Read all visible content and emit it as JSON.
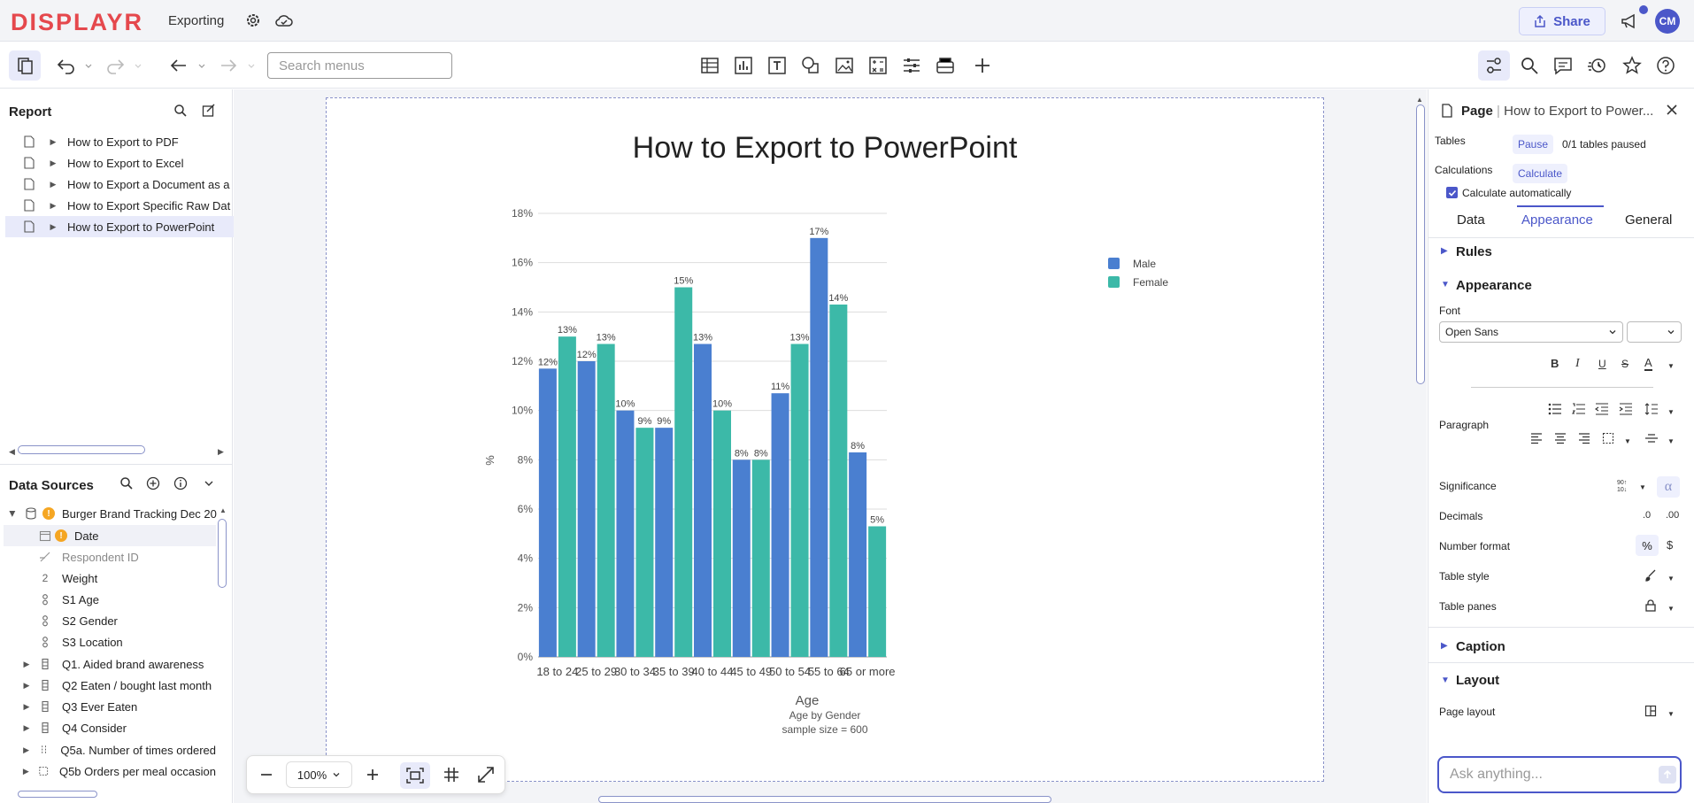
{
  "app": {
    "logo_text": "DISPLAYR",
    "document_title": "Exporting",
    "share_label": "Share",
    "user_initials": "CM"
  },
  "toolbar": {
    "search_placeholder": "Search menus"
  },
  "report": {
    "title": "Report",
    "pages": [
      {
        "label": "How to Export to PDF"
      },
      {
        "label": "How to Export to Excel"
      },
      {
        "label": "How to Export a Document as a"
      },
      {
        "label": "How to Export Specific Raw Dat"
      },
      {
        "label": "How to Export to PowerPoint",
        "selected": true
      }
    ]
  },
  "data_sources": {
    "title": "Data Sources",
    "root": "Burger Brand Tracking Dec 20",
    "items": [
      {
        "label": "Date",
        "type": "date"
      },
      {
        "label": "Respondent ID",
        "type": "id"
      },
      {
        "label": "Weight",
        "type": "numeric"
      },
      {
        "label": "S1 Age",
        "type": "categorical"
      },
      {
        "label": "S2 Gender",
        "type": "categorical"
      },
      {
        "label": "S3 Location",
        "type": "categorical"
      },
      {
        "label": "Q1. Aided brand awareness",
        "type": "multi"
      },
      {
        "label": "Q2 Eaten / bought last month",
        "type": "multi"
      },
      {
        "label": "Q3 Ever Eaten",
        "type": "multi"
      },
      {
        "label": "Q4 Consider",
        "type": "multi"
      },
      {
        "label": "Q5a. Number of times ordered",
        "type": "numeric-multi"
      },
      {
        "label": "Q5b Orders per meal occasion",
        "type": "numeric-multi"
      }
    ]
  },
  "zoom": {
    "value": "100%"
  },
  "right_panel": {
    "header_type": "Page",
    "header_title": "How to Export to Power...",
    "tables_label": "Tables",
    "pause_label": "Pause",
    "tables_status": "0/1 tables paused",
    "calculations_label": "Calculations",
    "calculate_label": "Calculate",
    "calc_auto_label": "Calculate automatically",
    "tabs": [
      "Data",
      "Appearance",
      "General"
    ],
    "sections": {
      "rules": "Rules",
      "appearance": "Appearance",
      "caption": "Caption",
      "layout": "Layout"
    },
    "font_label": "Font",
    "font_value": "Open Sans",
    "paragraph_label": "Paragraph",
    "significance_label": "Significance",
    "decimals_label": "Decimals",
    "number_format_label": "Number format",
    "table_style_label": "Table style",
    "table_panes_label": "Table panes",
    "page_layout_label": "Page layout",
    "ask_placeholder": "Ask anything..."
  },
  "chart_data": {
    "type": "bar",
    "title": "How to Export to PowerPoint",
    "xlabel": "Age",
    "ylabel": "%",
    "caption_lines": [
      "Age by Gender",
      "sample size = 600"
    ],
    "categories": [
      "18 to 24",
      "25 to 29",
      "30 to 34",
      "35 to 39",
      "40 to 44",
      "45 to 49",
      "50 to 54",
      "55 to 64",
      "65 or more"
    ],
    "series": [
      {
        "name": "Male",
        "color": "#4a7fd0",
        "values": [
          11.7,
          12.0,
          10.0,
          9.3,
          12.7,
          8.0,
          10.7,
          17.0,
          8.3
        ],
        "labels": [
          "12%",
          "12%",
          "10%",
          "9%",
          "13%",
          "8%",
          "11%",
          "17%",
          "8%"
        ]
      },
      {
        "name": "Female",
        "color": "#3cb9a8",
        "values": [
          13.0,
          12.7,
          9.3,
          15.0,
          10.0,
          8.0,
          12.7,
          14.3,
          5.3
        ],
        "labels": [
          "13%",
          "13%",
          "9%",
          "15%",
          "10%",
          "8%",
          "13%",
          "14%",
          "5%"
        ]
      }
    ],
    "yticks": [
      "0%",
      "2%",
      "4%",
      "6%",
      "8%",
      "10%",
      "12%",
      "14%",
      "16%",
      "18%"
    ],
    "ylim": [
      0,
      18
    ],
    "grid": true,
    "legend_position": "top-right"
  }
}
